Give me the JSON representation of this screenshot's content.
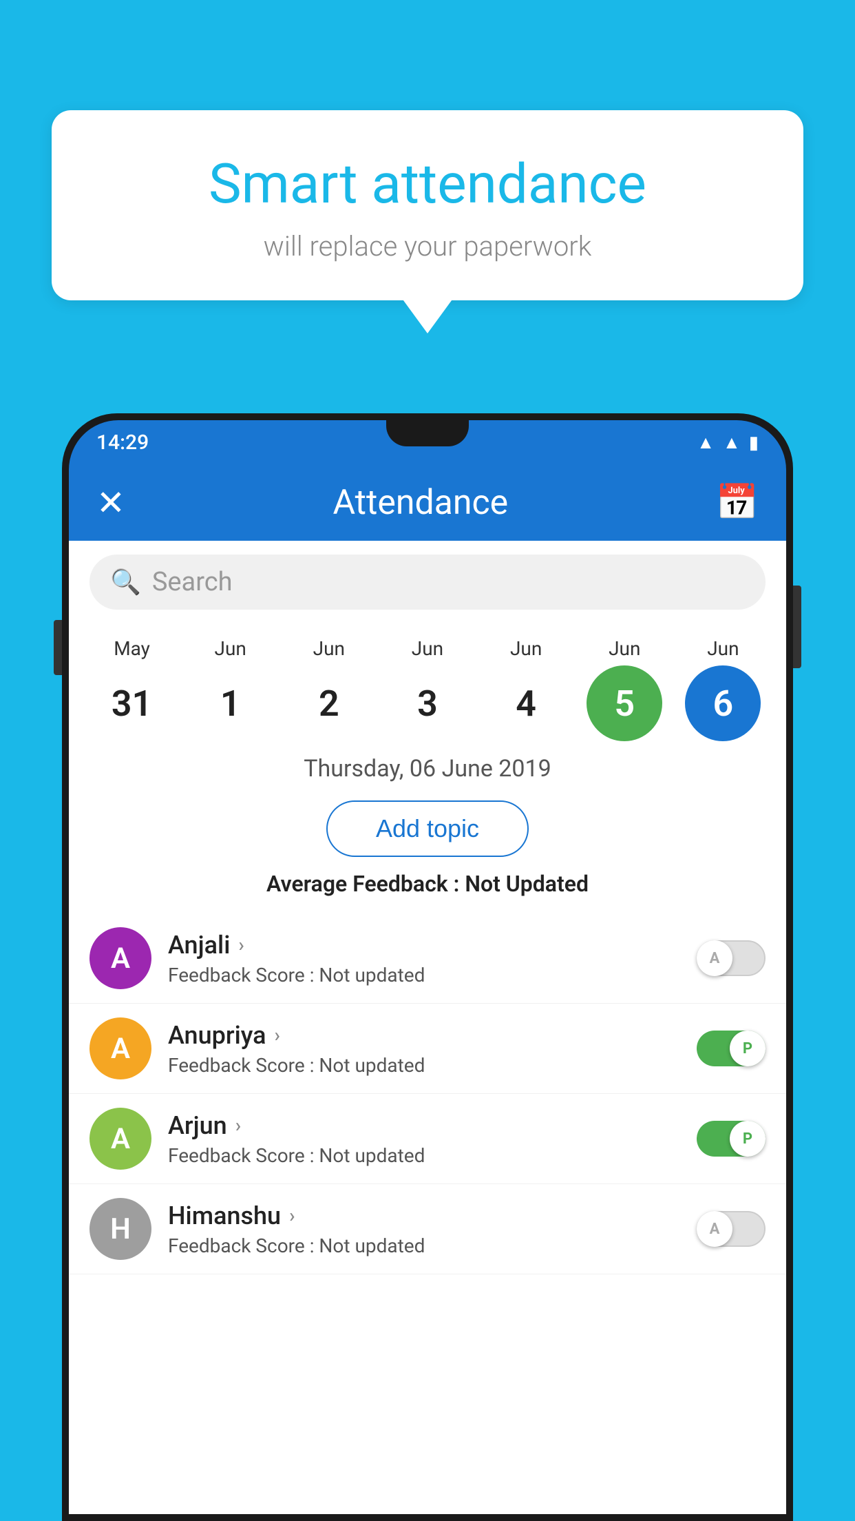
{
  "background_color": "#1ab8e8",
  "speech_bubble": {
    "title": "Smart attendance",
    "subtitle": "will replace your paperwork"
  },
  "phone": {
    "status_bar": {
      "time": "14:29",
      "icons": [
        "wifi",
        "signal",
        "battery"
      ]
    },
    "app_bar": {
      "close_label": "×",
      "title": "Attendance",
      "calendar_icon": "📅"
    },
    "search": {
      "placeholder": "Search"
    },
    "calendar": {
      "days": [
        {
          "month": "May",
          "date": "31",
          "style": "normal"
        },
        {
          "month": "Jun",
          "date": "1",
          "style": "normal"
        },
        {
          "month": "Jun",
          "date": "2",
          "style": "normal"
        },
        {
          "month": "Jun",
          "date": "3",
          "style": "normal"
        },
        {
          "month": "Jun",
          "date": "4",
          "style": "normal"
        },
        {
          "month": "Jun",
          "date": "5",
          "style": "green"
        },
        {
          "month": "Jun",
          "date": "6",
          "style": "blue"
        }
      ],
      "selected_date_label": "Thursday, 06 June 2019"
    },
    "add_topic_btn": "Add topic",
    "avg_feedback": {
      "label": "Average Feedback : ",
      "value": "Not Updated"
    },
    "students": [
      {
        "name": "Anjali",
        "avatar_letter": "A",
        "avatar_color": "#9c27b0",
        "score_label": "Feedback Score : ",
        "score_value": "Not updated",
        "toggle": "off",
        "toggle_label": "A"
      },
      {
        "name": "Anupriya",
        "avatar_letter": "A",
        "avatar_color": "#f5a623",
        "score_label": "Feedback Score : ",
        "score_value": "Not updated",
        "toggle": "on",
        "toggle_label": "P"
      },
      {
        "name": "Arjun",
        "avatar_letter": "A",
        "avatar_color": "#8bc34a",
        "score_label": "Feedback Score : ",
        "score_value": "Not updated",
        "toggle": "on",
        "toggle_label": "P"
      },
      {
        "name": "Himanshu",
        "avatar_letter": "H",
        "avatar_color": "#9e9e9e",
        "score_label": "Feedback Score : ",
        "score_value": "Not updated",
        "toggle": "off",
        "toggle_label": "A"
      }
    ]
  }
}
